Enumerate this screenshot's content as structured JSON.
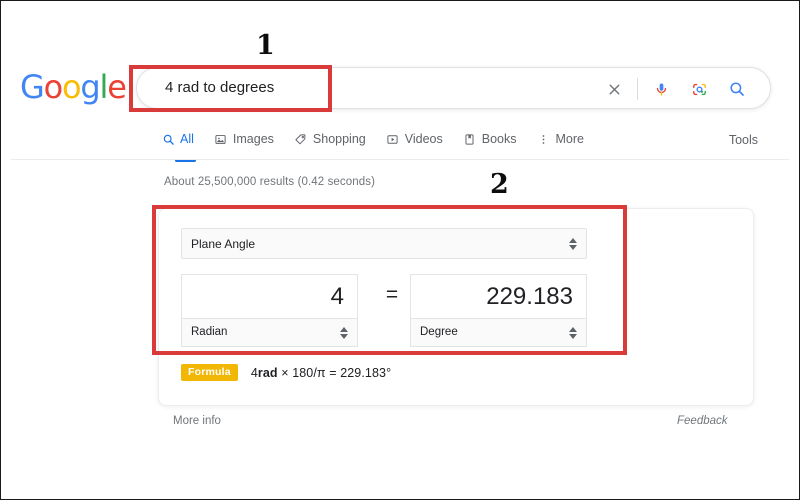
{
  "brand": {
    "logo_letters": [
      {
        "ch": "G",
        "color": "#4285F4"
      },
      {
        "ch": "o",
        "color": "#EA4335"
      },
      {
        "ch": "o",
        "color": "#FBBC05"
      },
      {
        "ch": "g",
        "color": "#4285F4"
      },
      {
        "ch": "l",
        "color": "#34A853"
      },
      {
        "ch": "e",
        "color": "#EA4335"
      }
    ],
    "logo_text": "Google"
  },
  "search": {
    "query": "4 rad to degrees",
    "placeholder": "Search",
    "icons": [
      "close-icon",
      "microphone-icon",
      "google-lens-icon",
      "search-icon"
    ]
  },
  "nav": {
    "tabs": [
      {
        "label": "All",
        "icon": "search-icon",
        "active": true
      },
      {
        "label": "Images",
        "icon": "image-icon",
        "active": false
      },
      {
        "label": "Shopping",
        "icon": "tag-icon",
        "active": false
      },
      {
        "label": "Videos",
        "icon": "video-icon",
        "active": false
      },
      {
        "label": "Books",
        "icon": "book-icon",
        "active": false
      },
      {
        "label": "More",
        "icon": "more-vertical-icon",
        "active": false
      }
    ],
    "tools_label": "Tools"
  },
  "results": {
    "stats": "About 25,500,000 results (0.42 seconds)"
  },
  "converter": {
    "category": "Plane Angle",
    "equals_sign": "=",
    "from": {
      "value": "4",
      "unit": "Radian"
    },
    "to": {
      "value": "229.183",
      "unit": "Degree"
    },
    "formula": {
      "badge": "Formula",
      "expr_lead": "4",
      "expr_unit": "rad",
      "expr_rest": " × 180/π = 229.183°"
    }
  },
  "footer": {
    "more_info": "More info",
    "feedback": "Feedback"
  },
  "annotations": {
    "colors": {
      "box": "#d93b3b",
      "number": "#0d0d0d"
    },
    "markers": [
      {
        "number": "1",
        "target": "search-box"
      },
      {
        "number": "2",
        "target": "unit-converter"
      }
    ]
  }
}
